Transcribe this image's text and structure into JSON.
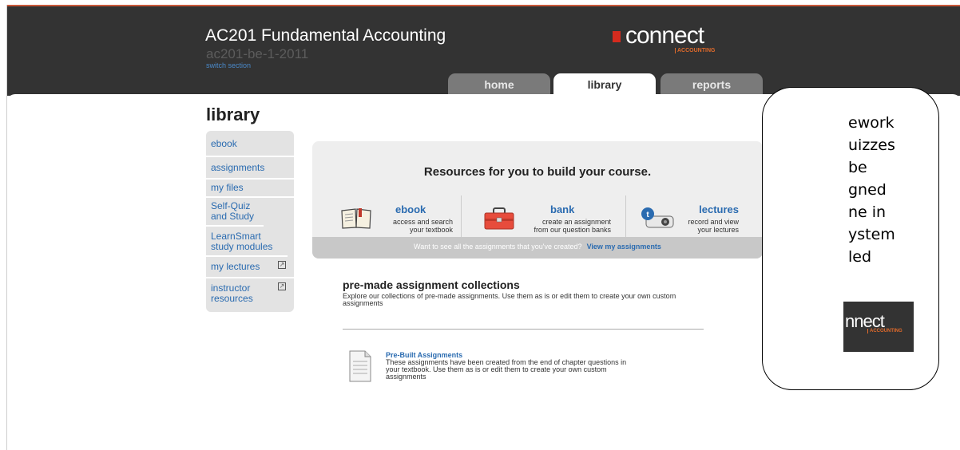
{
  "header": {
    "course_title": "AC201 Fundamental Accounting",
    "course_code": "ac201-be-1-2011",
    "switch_section": "switch section",
    "logo": {
      "word": "connect",
      "sub": "ACCOUNTING"
    }
  },
  "tabs": [
    {
      "label": "home",
      "active": false
    },
    {
      "label": "library",
      "active": true
    },
    {
      "label": "reports",
      "active": false
    }
  ],
  "page_title": "library",
  "sidebar": {
    "items": [
      {
        "label": "ebook"
      },
      {
        "label": "assignments"
      },
      {
        "label": "my files"
      },
      {
        "label": "Self-Quiz and Study"
      },
      {
        "label": "LearnSmart study modules"
      },
      {
        "label": "my lectures"
      },
      {
        "label": "instructor resources"
      }
    ]
  },
  "resources": {
    "heading": "Resources for you to build your course.",
    "items": [
      {
        "title": "ebook",
        "desc1": "access and search",
        "desc2": "your textbook",
        "icon": "book-icon"
      },
      {
        "title": "bank",
        "desc1": "create an assignment",
        "desc2": "from our question banks",
        "icon": "toolbox-icon"
      },
      {
        "title": "lectures",
        "desc1": "record and view",
        "desc2": "your lectures",
        "icon": "projector-icon"
      }
    ],
    "footer_text": "Want to see all the assignments that you've created?",
    "footer_link": "View my assignments"
  },
  "premade": {
    "title": "pre-made assignment collections",
    "desc": "Explore our collections of pre-made assignments. Use them as is or edit them to create your own custom assignments"
  },
  "prebuilt": {
    "title": "Pre-Built Assignments",
    "desc": "These assignments have been created from the end of chapter questions in your textbook. Use them as is or edit them to create your own custom assignments"
  },
  "callout": {
    "text": "ework\nuizzes\nbe\ngned\nne in\nystem\nled",
    "logo_word": "nnect",
    "logo_sub": "ACCOUNTING"
  },
  "colors": {
    "header_bg": "#333333",
    "link": "#2a6bb0",
    "accent": "#d52b1e"
  }
}
